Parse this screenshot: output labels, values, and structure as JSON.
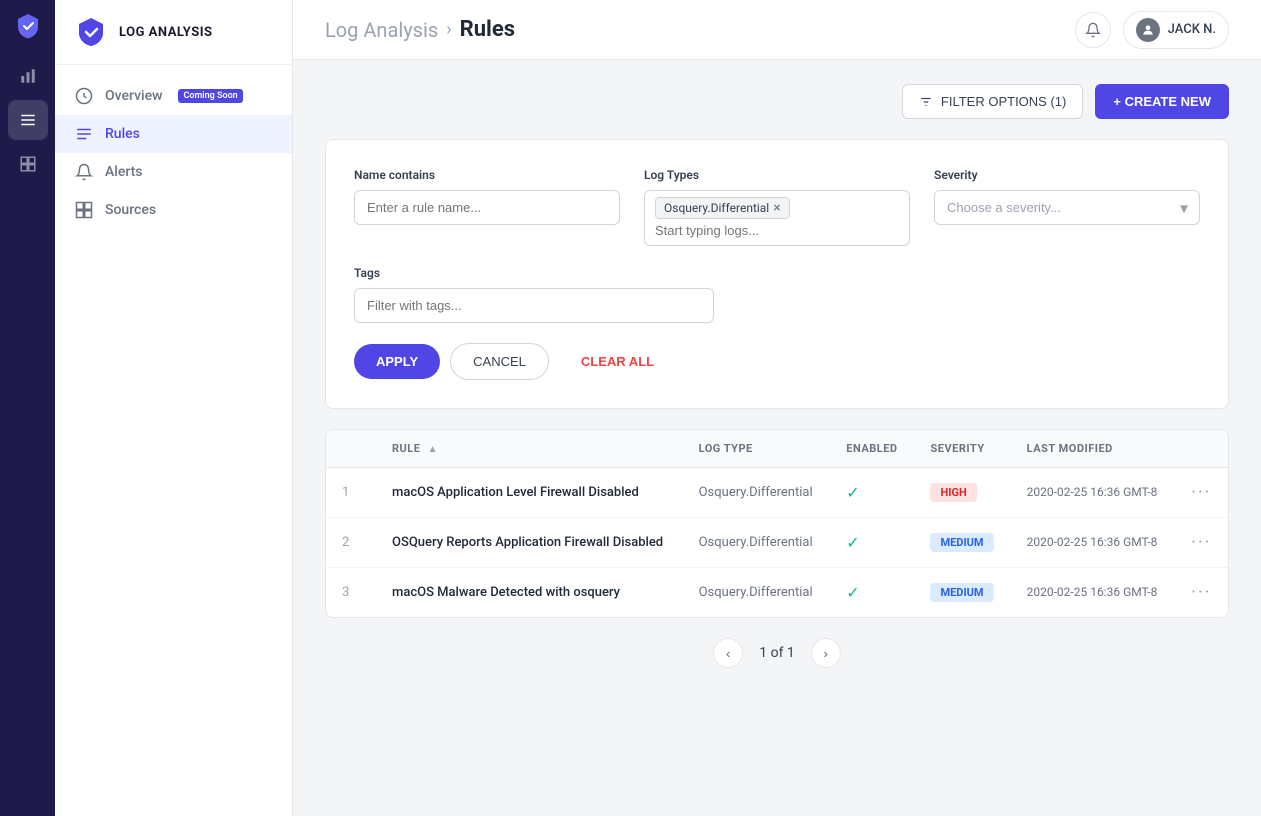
{
  "app": {
    "title": "LOG ANALYSIS"
  },
  "leftbar": {
    "items": [
      {
        "id": "shield",
        "icon": "🛡",
        "active": true
      },
      {
        "id": "graph",
        "icon": "📊",
        "active": false
      },
      {
        "id": "rules",
        "icon": "≡",
        "active": true
      },
      {
        "id": "sources",
        "icon": "⊞",
        "active": false
      }
    ]
  },
  "sidebar": {
    "items": [
      {
        "id": "overview",
        "label": "Overview",
        "badge": "Coming Soon",
        "active": false
      },
      {
        "id": "rules",
        "label": "Rules",
        "badge": null,
        "active": true
      },
      {
        "id": "alerts",
        "label": "Alerts",
        "badge": null,
        "active": false
      },
      {
        "id": "sources",
        "label": "Sources",
        "badge": null,
        "active": false
      }
    ]
  },
  "header": {
    "breadcrumb_parent": "Log Analysis",
    "breadcrumb_sep": "›",
    "breadcrumb_current": "Rules",
    "user_name": "JACK N.",
    "filter_btn": "FILTER OPTIONS (1)",
    "create_btn": "+ CREATE NEW"
  },
  "filters": {
    "name_label": "Name contains",
    "name_placeholder": "Enter a rule name...",
    "log_types_label": "Log Types",
    "log_types_chip": "Osquery.Differential",
    "log_types_placeholder": "Start typing logs...",
    "severity_label": "Severity",
    "severity_placeholder": "Choose a severity...",
    "tags_label": "Tags",
    "tags_placeholder": "Filter with tags...",
    "apply_label": "APPLY",
    "cancel_label": "CANCEL",
    "clear_label": "CLEAR ALL"
  },
  "table": {
    "columns": [
      "#",
      "RULE",
      "LOG TYPE",
      "ENABLED",
      "SEVERITY",
      "LAST MODIFIED",
      ""
    ],
    "rows": [
      {
        "num": "1",
        "rule": "macOS Application Level Firewall Disabled",
        "log_type": "Osquery.Differential",
        "enabled": true,
        "severity": "HIGH",
        "severity_type": "high",
        "last_modified": "2020-02-25 16:36 GMT-8"
      },
      {
        "num": "2",
        "rule": "OSQuery Reports Application Firewall Disabled",
        "log_type": "Osquery.Differential",
        "enabled": true,
        "severity": "MEDIUM",
        "severity_type": "medium",
        "last_modified": "2020-02-25 16:36 GMT-8"
      },
      {
        "num": "3",
        "rule": "macOS Malware Detected with osquery",
        "log_type": "Osquery.Differential",
        "enabled": true,
        "severity": "MEDIUM",
        "severity_type": "medium",
        "last_modified": "2020-02-25 16:36 GMT-8"
      }
    ]
  },
  "pagination": {
    "current": "1",
    "total": "1",
    "label": "of 1"
  }
}
